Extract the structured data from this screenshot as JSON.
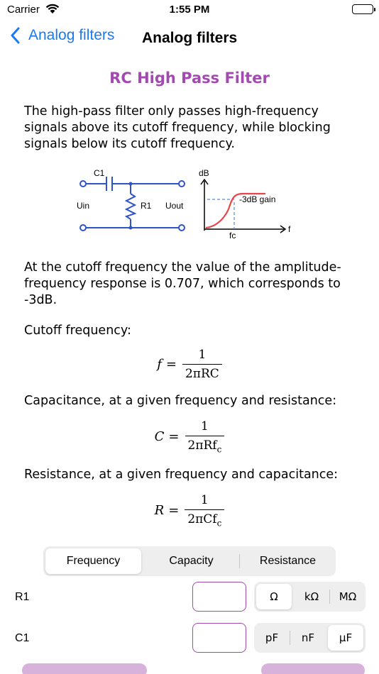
{
  "status_bar": {
    "carrier": "Carrier",
    "time": "1:55 PM"
  },
  "nav": {
    "back_label": "Analog filters",
    "title": "Analog filters"
  },
  "content": {
    "heading": "RC High Pass Filter",
    "intro": "The high-pass filter only passes high-frequency signals above its cutoff frequency, while blocking signals below its cutoff frequency.",
    "cutoff_note": "At the cutoff frequency the value of the amplitude-frequency response is 0.707, which corresponds to -3dB.",
    "cutoff_label": "Cutoff frequency:",
    "capacitance_label": "Capacitance, at a given frequency and resistance:",
    "resistance_label": "Resistance, at a given frequency and capacitance:"
  },
  "diagram": {
    "c1": "C1",
    "r1": "R1",
    "uin": "Uin",
    "uout": "Uout",
    "db": "dB",
    "gain": "-3dB gain",
    "fc": "fc",
    "f": "f",
    "circuit_color": "#2f54c8",
    "curve_color": "#e8454a"
  },
  "formulas": {
    "f1": {
      "lhs": "f",
      "num": "1",
      "den": "2πRC"
    },
    "f2": {
      "lhs": "C",
      "num": "1",
      "den_main": "2πRf",
      "den_sub": "c"
    },
    "f3": {
      "lhs": "R",
      "num": "1",
      "den_main": "2πCf",
      "den_sub": "c"
    }
  },
  "segment": {
    "items": [
      "Frequency",
      "Capacity",
      "Resistance"
    ],
    "selected": "Frequency"
  },
  "rows": [
    {
      "label": "R1",
      "value": "",
      "units": [
        "Ω",
        "kΩ",
        "MΩ"
      ],
      "selected": "Ω"
    },
    {
      "label": "C1",
      "value": "",
      "units": [
        "pF",
        "nF",
        "µF"
      ],
      "selected": "µF"
    }
  ],
  "colors": {
    "accent": "#a24ab0",
    "link": "#1a7bf2"
  }
}
